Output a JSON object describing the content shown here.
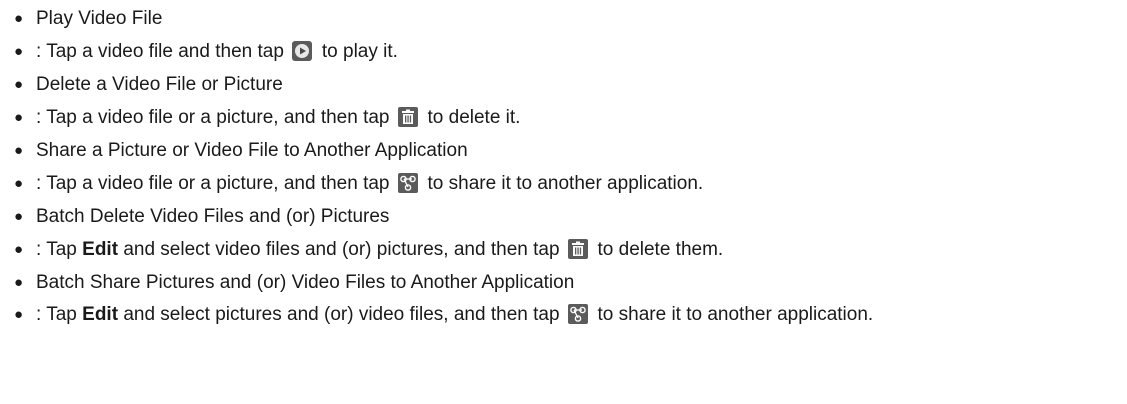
{
  "items": [
    {
      "type": "heading",
      "text": "Play Video File"
    },
    {
      "type": "step",
      "prefix": ": Tap a video file and then tap",
      "icon": "play-icon",
      "suffix": "to play it."
    },
    {
      "type": "heading",
      "text": "Delete a Video File or Picture"
    },
    {
      "type": "step",
      "prefix": ": Tap a video file or a picture, and then tap",
      "icon": "trash-icon",
      "suffix": "to delete it."
    },
    {
      "type": "heading",
      "text": "Share a Picture or Video File to Another Application"
    },
    {
      "type": "step",
      "prefix": ": Tap a video file or a picture, and then tap",
      "icon": "share-icon",
      "suffix": "to share it to another application."
    },
    {
      "type": "heading",
      "text": "Batch Delete Video Files and (or) Pictures"
    },
    {
      "type": "step",
      "pre": ": Tap",
      "bold": "Edit",
      "prefix": "and select video files and (or) pictures, and then tap",
      "icon": "trash-icon",
      "suffix": "to delete them."
    },
    {
      "type": "heading",
      "text": "Batch Share Pictures and (or) Video Files to Another Application"
    },
    {
      "type": "step",
      "pre": ": Tap",
      "bold": "Edit",
      "prefix": "and select pictures and (or) video files, and then tap",
      "icon": "share-icon",
      "suffix": "to share it to another application."
    }
  ],
  "bullet_char": "●",
  "colors": {
    "text": "#1a1a1a",
    "icon_bg": "#5b5b5b",
    "icon_fg": "#ffffff"
  }
}
